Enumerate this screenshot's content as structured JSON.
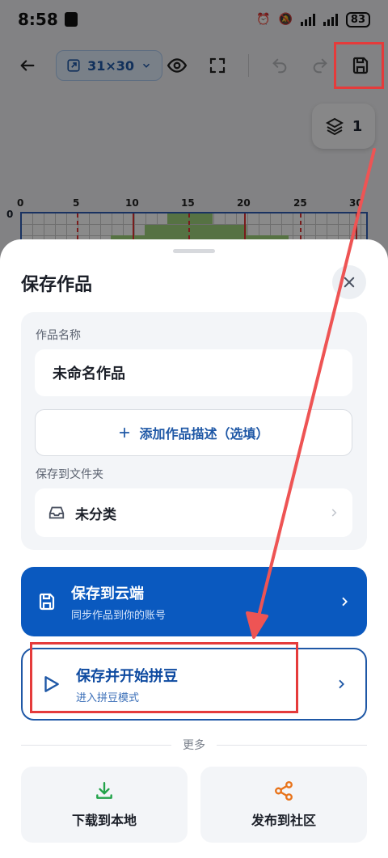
{
  "status_bar": {
    "time": "8:58",
    "battery": "83"
  },
  "toolbar": {
    "grid_size": "31×30"
  },
  "layers": {
    "count": "1"
  },
  "grid": {
    "ruler_top": [
      "0",
      "5",
      "10",
      "15",
      "20",
      "25",
      "30"
    ],
    "ruler_left": "0"
  },
  "sheet": {
    "title": "保存作品",
    "name_label": "作品名称",
    "name_value": "未命名作品",
    "add_desc_label": "添加作品描述（选填）",
    "folder_label": "保存到文件夹",
    "folder_value": "未分类",
    "save_cloud": {
      "title": "保存到云端",
      "subtitle": "同步作品到你的账号"
    },
    "save_bead": {
      "title": "保存并开始拼豆",
      "subtitle": "进入拼豆模式"
    },
    "more_label": "更多",
    "actions": [
      {
        "label": "下载到本地"
      },
      {
        "label": "发布到社区"
      }
    ]
  },
  "colors": {
    "primary": "#0a59bf",
    "highlight": "#e53b3b",
    "download": "#22a34a",
    "share": "#e8731a"
  }
}
